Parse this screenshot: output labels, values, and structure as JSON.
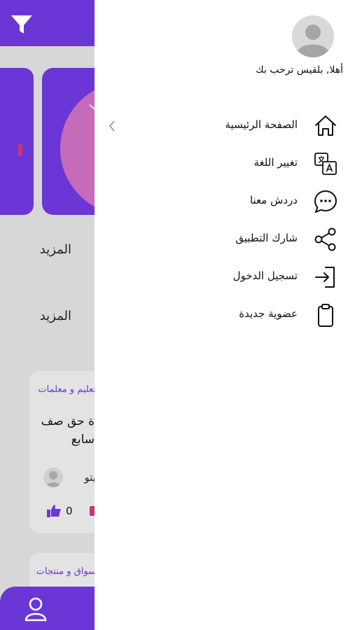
{
  "background": {
    "more_label_1": "المزيد",
    "more_label_2": "المزيد",
    "posts": [
      {
        "category": "تعليم و معلمات",
        "title_line1": "ة حق صف",
        "title_line2": "سابع",
        "username": "يتو",
        "likes": "0"
      },
      {
        "category": "سواق و منتجات"
      }
    ]
  },
  "drawer": {
    "greeting": "أهلا, بلقيس ترحب بك",
    "menu": [
      {
        "label": "الصفحة الرئيسية",
        "icon": "home-icon"
      },
      {
        "label": "تغيير اللغة",
        "icon": "translate-icon"
      },
      {
        "label": "دردش معنا",
        "icon": "chat-icon"
      },
      {
        "label": "شارك التطبيق",
        "icon": "share-icon"
      },
      {
        "label": "تسجيل الدخول",
        "icon": "login-icon"
      },
      {
        "label": "عضوية جديدة",
        "icon": "clipboard-icon"
      }
    ]
  },
  "colors": {
    "accent": "#6a37d6",
    "scrim": "#d7d7d7",
    "drawer_bg": "#ffffff",
    "pink": "#c66aba"
  }
}
